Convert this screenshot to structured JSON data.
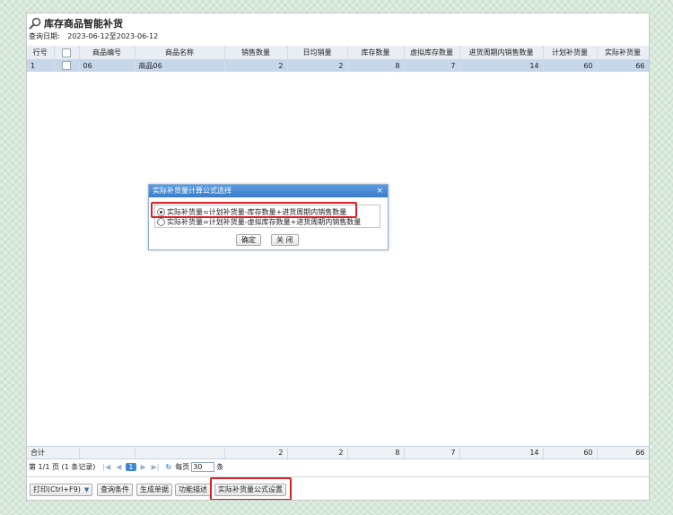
{
  "page": {
    "title": "库存商品智能补货",
    "query_label": "查询日期:",
    "query_value": "2023-06-12至2023-06-12"
  },
  "grid": {
    "columns": [
      "行号",
      "",
      "商品编号",
      "商品名称",
      "销售数量",
      "日均销量",
      "库存数量",
      "虚拟库存数量",
      "进货周期内销售数量",
      "计划补货量",
      "实际补货量"
    ],
    "rows": [
      {
        "row_no": "1",
        "code": "06",
        "name": "商品06",
        "sales_qty": "2",
        "daily_avg": "2",
        "stock_qty": "8",
        "virtual_stock": "7",
        "cycle_sales": "14",
        "plan_qty": "60",
        "actual_qty": "66"
      }
    ],
    "footer": {
      "label": "合计",
      "sales_qty": "2",
      "daily_avg": "2",
      "stock_qty": "8",
      "virtual_stock": "7",
      "cycle_sales": "14",
      "plan_qty": "60",
      "actual_qty": "66"
    }
  },
  "pager": {
    "info": "第 1/1 页 (1 条记录)",
    "first": "|◀",
    "prev": "◀",
    "current": "1",
    "next": "▶",
    "last": "▶|",
    "refresh": "↻",
    "size_label": "每页",
    "size_value": "30",
    "size_unit": "条"
  },
  "toolbar": {
    "print_label": "打印(Ctrl+F9)",
    "print_arrow": "▼",
    "query_btn": "查询条件",
    "generate_btn": "生成单据",
    "desc_btn": "功能描述",
    "formula_btn": "实际补货量公式设置"
  },
  "dialog": {
    "title": "实际补货量计算公式选择",
    "close": "×",
    "options": [
      {
        "label": "实际补货量=计划补货量-库存数量+进货周期内销售数量",
        "selected": true
      },
      {
        "label": "实际补货量=计划补货量-虚拟库存数量+进货周期内销售数量",
        "selected": false
      }
    ],
    "ok": "确定",
    "cancel": "关 闭"
  },
  "colors": {
    "accent": "#3a7cc9",
    "highlight": "#d6232a",
    "selected_row": "#c7d7ea"
  }
}
